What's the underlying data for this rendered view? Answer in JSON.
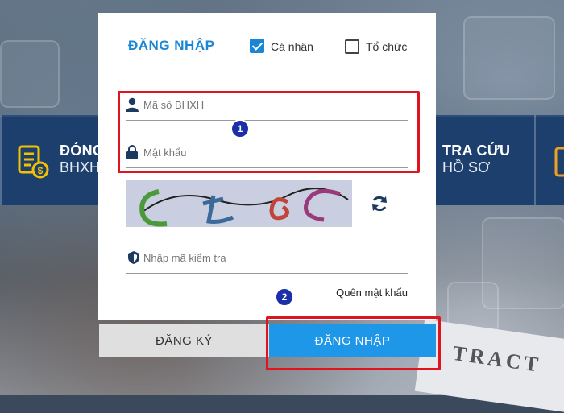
{
  "band": {
    "left_title": "ĐÓNG",
    "left_sub": "BHXH",
    "right_title": "TRA CỨU",
    "right_sub": "HỒ SƠ"
  },
  "background": {
    "contract_text": "TRACT"
  },
  "login": {
    "title": "ĐĂNG NHẬP",
    "account_types": [
      {
        "label": "Cá nhân",
        "checked": true
      },
      {
        "label": "Tổ chức",
        "checked": false
      }
    ],
    "username_placeholder": "Mã số BHXH",
    "password_placeholder": "Mật khẩu",
    "captcha_text": "CL6e",
    "captcha_placeholder": "Nhập mã kiểm tra",
    "forgot_password": "Quên mật khẩu",
    "register_button": "ĐĂNG KÝ",
    "login_button": "ĐĂNG NHẬP"
  },
  "annotations": {
    "badge1": "1",
    "badge2": "2"
  },
  "colors": {
    "accent": "#1a86d6",
    "login_button": "#1f97e8",
    "highlight": "#e0141e",
    "band": "#1c3f6e"
  },
  "icons": [
    "user-icon",
    "lock-icon",
    "shield-icon",
    "refresh-icon",
    "bill-icon",
    "folder-icon"
  ]
}
